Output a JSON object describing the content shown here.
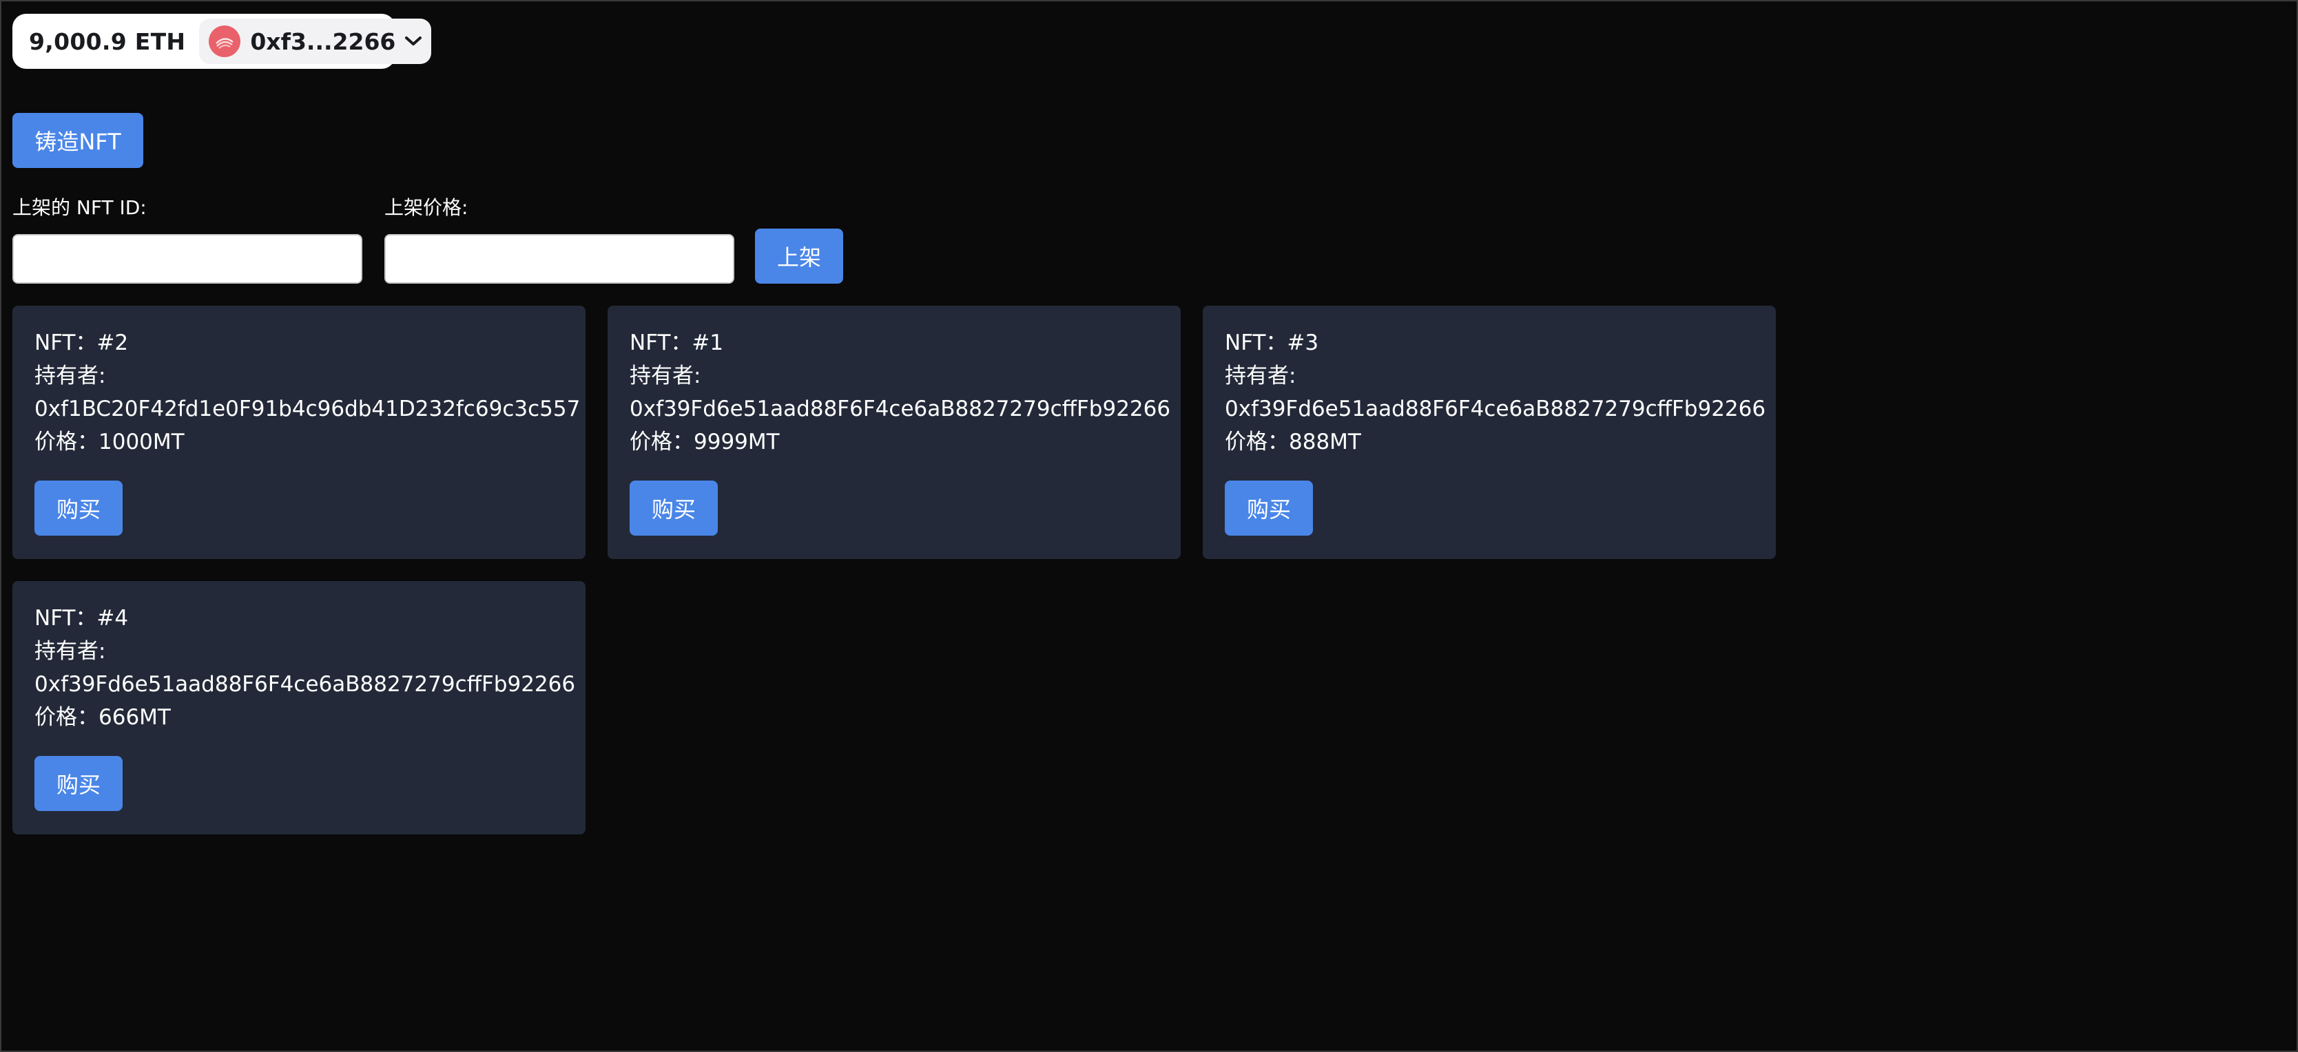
{
  "wallet": {
    "balance": "9,000.9 ETH",
    "address": "0xf3...2266",
    "avatar_color": "#e9616a"
  },
  "mint": {
    "label": "铸造NFT"
  },
  "listing": {
    "nft_id_label": "上架的 NFT ID:",
    "price_label": "上架价格:",
    "nft_id_value": "",
    "price_value": "",
    "submit_label": "上架"
  },
  "cards": [
    {
      "nft": "NFT：#2",
      "owner_label": "持有者:",
      "owner": "0xf1BC20F42fd1e0F91b4c96db41D232fc69c3c557",
      "price": "价格：1000MT",
      "buy_label": "购买"
    },
    {
      "nft": "NFT：#1",
      "owner_label": "持有者:",
      "owner": "0xf39Fd6e51aad88F6F4ce6aB8827279cffFb92266",
      "price": "价格：9999MT",
      "buy_label": "购买"
    },
    {
      "nft": "NFT：#3",
      "owner_label": "持有者:",
      "owner": "0xf39Fd6e51aad88F6F4ce6aB8827279cffFb92266",
      "price": "价格：888MT",
      "buy_label": "购买"
    },
    {
      "nft": "NFT：#4",
      "owner_label": "持有者:",
      "owner": "0xf39Fd6e51aad88F6F4ce6aB8827279cffFb92266",
      "price": "价格：666MT",
      "buy_label": "购买"
    }
  ],
  "colors": {
    "background": "#0a0a0a",
    "card": "#232938",
    "accent": "#4a86e8"
  },
  "icons": {
    "avatar": "wallet-avatar-icon",
    "chevron": "chevron-down-icon"
  }
}
